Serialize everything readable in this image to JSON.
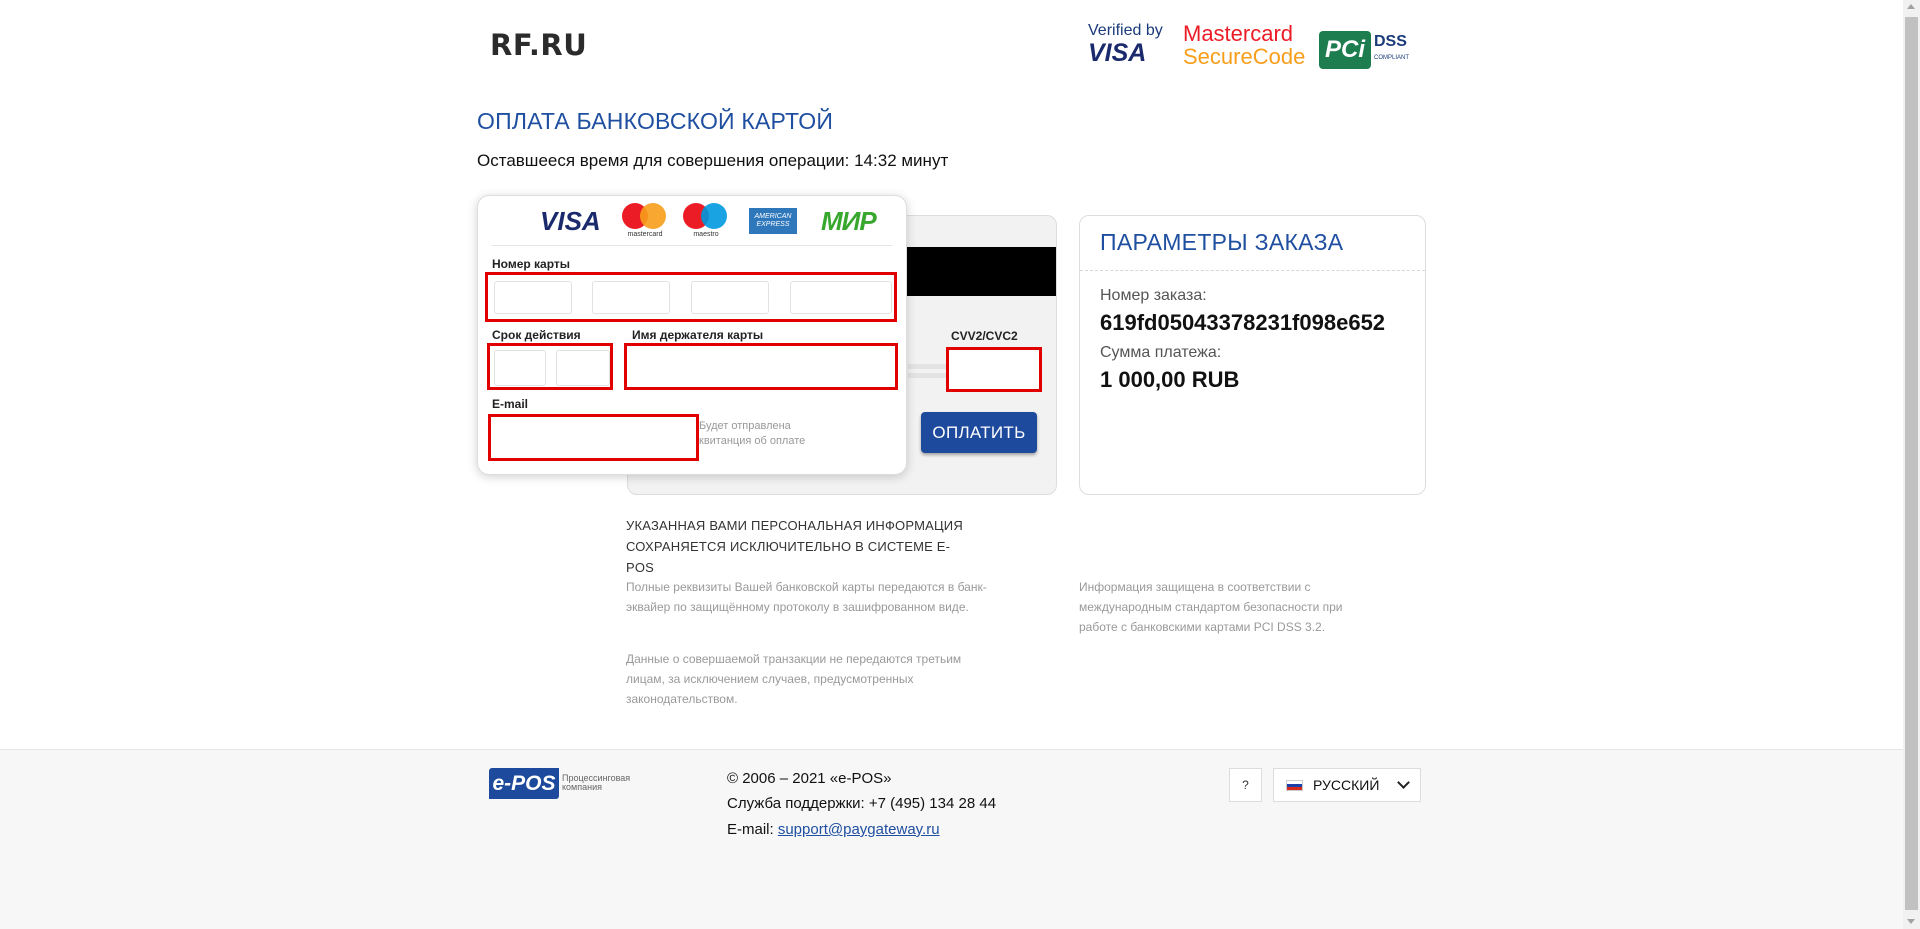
{
  "header": {
    "logo": "RF.RU",
    "trust": {
      "visa_line1": "Verified by",
      "visa_line2": "VISA",
      "mc_line1": "Mastercard",
      "mc_line2": "SecureCode",
      "pci_mark": "PCi",
      "pci_dss": "DSS",
      "pci_compliant": "COMPLIANT"
    }
  },
  "page": {
    "title": "ОПЛАТА БАНКОВСКОЙ КАРТОЙ",
    "timer": "Оставшееся время для совершения операции: 14:32 минут"
  },
  "brands": {
    "visa": "VISA",
    "mastercard": "mastercard",
    "maestro": "maestro",
    "amex": "AMERICAN EXPRESS",
    "mir": "МИР"
  },
  "form": {
    "card_number_label": "Номер карты",
    "expiry_label": "Срок действия",
    "holder_label": "Имя держателя карты",
    "cvv_label": "CVV2/CVC2",
    "email_label": "E-mail",
    "email_hint": "Будет отправлена квитанция об оплате",
    "pay_button": "ОПЛАТИТЬ"
  },
  "order": {
    "title": "ПАРАМЕТРЫ ЗАКАЗА",
    "number_label": "Номер заказа:",
    "number_value": "619fd05043378231f098e652",
    "amount_label": "Сумма платежа:",
    "amount_value": "1 000,00 RUB"
  },
  "info": {
    "heading": "УКАЗАННАЯ ВАМИ ПЕРСОНАЛЬНАЯ ИНФОРМАЦИЯ СОХРАНЯЕТСЯ ИСКЛЮЧИТЕЛЬНО В СИСТЕМЕ E-POS",
    "para1": "Полные реквизиты Вашей банковской карты передаются в банк-эквайер по защищённому протоколу в зашифрованном виде.",
    "para2": "Данные о совершаемой транзакции не передаются третьим лицам, за исключением случаев, предусмотренных законодательством.",
    "para3": "Информация защищена в соответствии с международным стандартом безопасности при работе с банковскими картами PCI DSS 3.2."
  },
  "footer": {
    "logo": "e-POS",
    "tagline": "Процессинговая компания",
    "copyright": "© 2006 – 2021 «e-POS»",
    "support": "Служба поддержки: +7 (495) 134 28 44",
    "email_label": "E-mail:",
    "email_link": "support@paygateway.ru",
    "help": "?",
    "language": "РУССКИЙ"
  },
  "colors": {
    "accent": "#1f4fa0",
    "button": "#1d4a9c",
    "highlight_border": "#e00000"
  }
}
